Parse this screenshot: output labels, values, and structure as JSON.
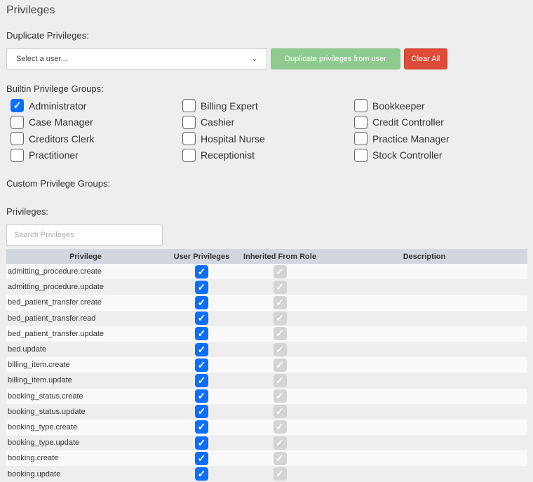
{
  "title": "Privileges",
  "duplicate": {
    "label": "Duplicate Privileges:",
    "select_value": "Select a user...",
    "duplicate_button": "Duplicate privileges from user",
    "clear_button": "Clear All"
  },
  "builtin": {
    "label": "Builtin Privilege Groups:",
    "groups": [
      {
        "label": "Administrator",
        "checked": true
      },
      {
        "label": "Billing Expert",
        "checked": false
      },
      {
        "label": "Bookkeeper",
        "checked": false
      },
      {
        "label": "Case Manager",
        "checked": false
      },
      {
        "label": "Cashier",
        "checked": false
      },
      {
        "label": "Credit Controller",
        "checked": false
      },
      {
        "label": "Creditors Clerk",
        "checked": false
      },
      {
        "label": "Hospital Nurse",
        "checked": false
      },
      {
        "label": "Practice Manager",
        "checked": false
      },
      {
        "label": "Practitioner",
        "checked": false
      },
      {
        "label": "Receptionist",
        "checked": false
      },
      {
        "label": "Stock Controller",
        "checked": false
      }
    ]
  },
  "custom": {
    "label": "Custom Privilege Groups:"
  },
  "privileges": {
    "label": "Privileges:",
    "search_placeholder": "Search Privileges",
    "columns": [
      "Privilege",
      "User Privileges",
      "Inherited From Role",
      "Description"
    ],
    "rows": [
      {
        "name": "admitting_procedure.create",
        "user": true,
        "inherited": true,
        "description": ""
      },
      {
        "name": "admitting_procedure.update",
        "user": true,
        "inherited": true,
        "description": ""
      },
      {
        "name": "bed_patient_transfer.create",
        "user": true,
        "inherited": true,
        "description": ""
      },
      {
        "name": "bed_patient_transfer.read",
        "user": true,
        "inherited": true,
        "description": ""
      },
      {
        "name": "bed_patient_transfer.update",
        "user": true,
        "inherited": true,
        "description": ""
      },
      {
        "name": "bed.update",
        "user": true,
        "inherited": true,
        "description": ""
      },
      {
        "name": "billing_item.create",
        "user": true,
        "inherited": true,
        "description": ""
      },
      {
        "name": "billing_item.update",
        "user": true,
        "inherited": true,
        "description": ""
      },
      {
        "name": "booking_status.create",
        "user": true,
        "inherited": true,
        "description": ""
      },
      {
        "name": "booking_status.update",
        "user": true,
        "inherited": true,
        "description": ""
      },
      {
        "name": "booking_type.create",
        "user": true,
        "inherited": true,
        "description": ""
      },
      {
        "name": "booking_type.update",
        "user": true,
        "inherited": true,
        "description": ""
      },
      {
        "name": "booking.create",
        "user": true,
        "inherited": true,
        "description": ""
      },
      {
        "name": "booking.update",
        "user": true,
        "inherited": true,
        "description": ""
      }
    ]
  }
}
